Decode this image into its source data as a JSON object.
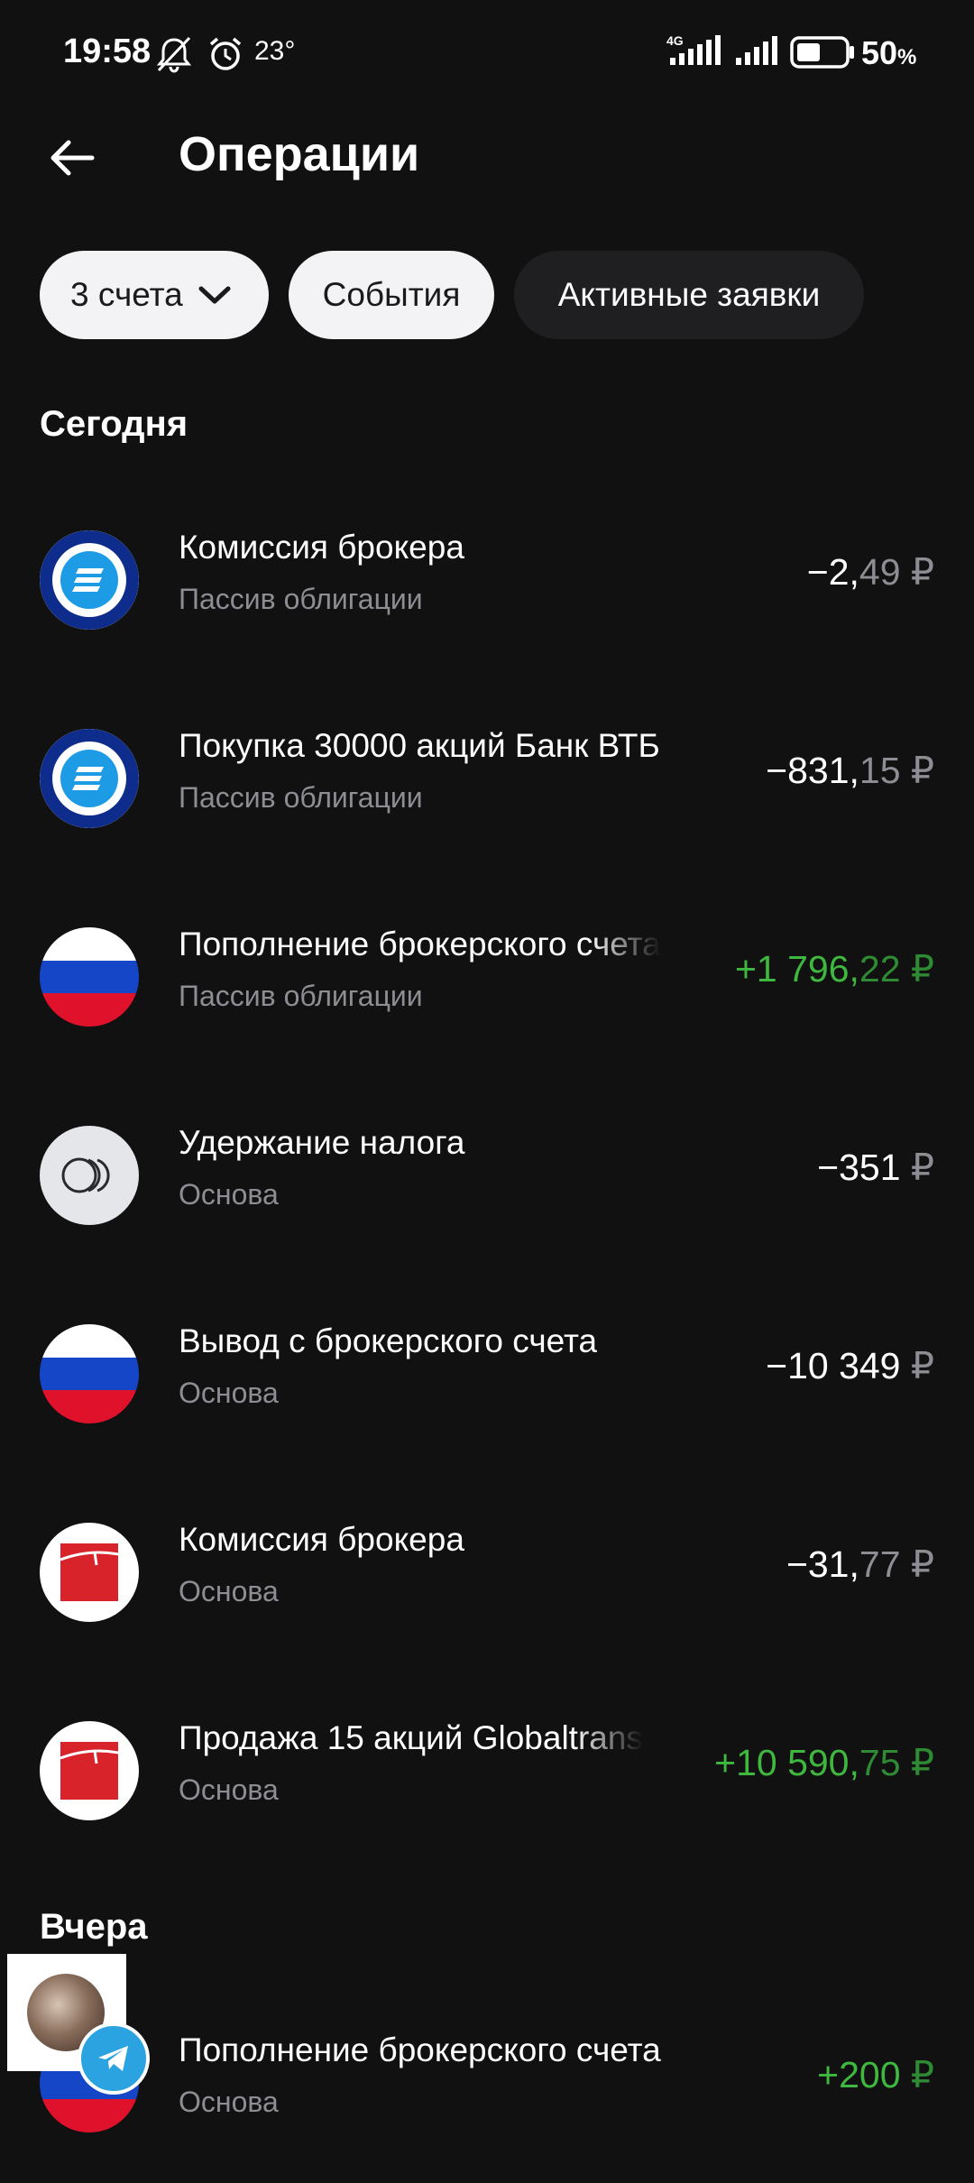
{
  "status_bar": {
    "time": "19:58",
    "temperature": "23°",
    "battery_percent": "50",
    "battery_unit": "%",
    "network": "4G",
    "battery_level": 0.5
  },
  "header": {
    "title": "Операции",
    "back_icon": "arrow-left-icon"
  },
  "filters": {
    "accounts_label": "3 счета",
    "events_label": "События",
    "active_orders_label": "Активные заявки"
  },
  "sections": [
    {
      "title": "Сегодня",
      "operations": [
        {
          "title": "Комиссия брокера",
          "subtitle": "Пассив облигации",
          "amount_int": "−2,",
          "amount_frac": "49",
          "currency": "₽",
          "sign": "neg",
          "icon": "broker-blue-logo"
        },
        {
          "title": "Покупка 30000 акций Банк ВТБ",
          "subtitle": "Пассив облигации",
          "amount_int": "−831,",
          "amount_frac": "15",
          "currency": "₽",
          "sign": "neg",
          "icon": "broker-blue-logo"
        },
        {
          "title": "Пополнение брокерского счета",
          "subtitle": "Пассив облигации",
          "amount_int": "+1 796,",
          "amount_frac": "22",
          "currency": "₽",
          "sign": "pos",
          "icon": "russia-flag"
        },
        {
          "title": "Удержание налога",
          "subtitle": "Основа",
          "amount_int": "−351",
          "amount_frac": "",
          "currency": "₽",
          "sign": "neg",
          "icon": "coins-icon"
        },
        {
          "title": "Вывод с брокерского счета",
          "subtitle": "Основа",
          "amount_int": "−10 349",
          "amount_frac": "",
          "currency": "₽",
          "sign": "neg",
          "icon": "russia-flag"
        },
        {
          "title": "Комиссия брокера",
          "subtitle": "Основа",
          "amount_int": "−31,",
          "amount_frac": "77",
          "currency": "₽",
          "sign": "neg",
          "icon": "red-square-logo"
        },
        {
          "title": "Продажа 15 акций Globaltrans",
          "subtitle": "Основа",
          "amount_int": "+10 590,",
          "amount_frac": "75",
          "currency": "₽",
          "sign": "pos",
          "icon": "red-square-logo"
        }
      ]
    },
    {
      "title": "Вчера",
      "operations": [
        {
          "title": "Пополнение брокерского счета",
          "subtitle": "Основа",
          "amount_int": "+200",
          "amount_frac": "",
          "currency": "₽",
          "sign": "pos",
          "icon": "russia-flag"
        }
      ]
    }
  ],
  "colors": {
    "background": "#111111",
    "positive": "#3fb83f",
    "muted": "#8d8d93",
    "chip_light": "#f3f3f6",
    "chip_dark": "#1f1f22"
  }
}
